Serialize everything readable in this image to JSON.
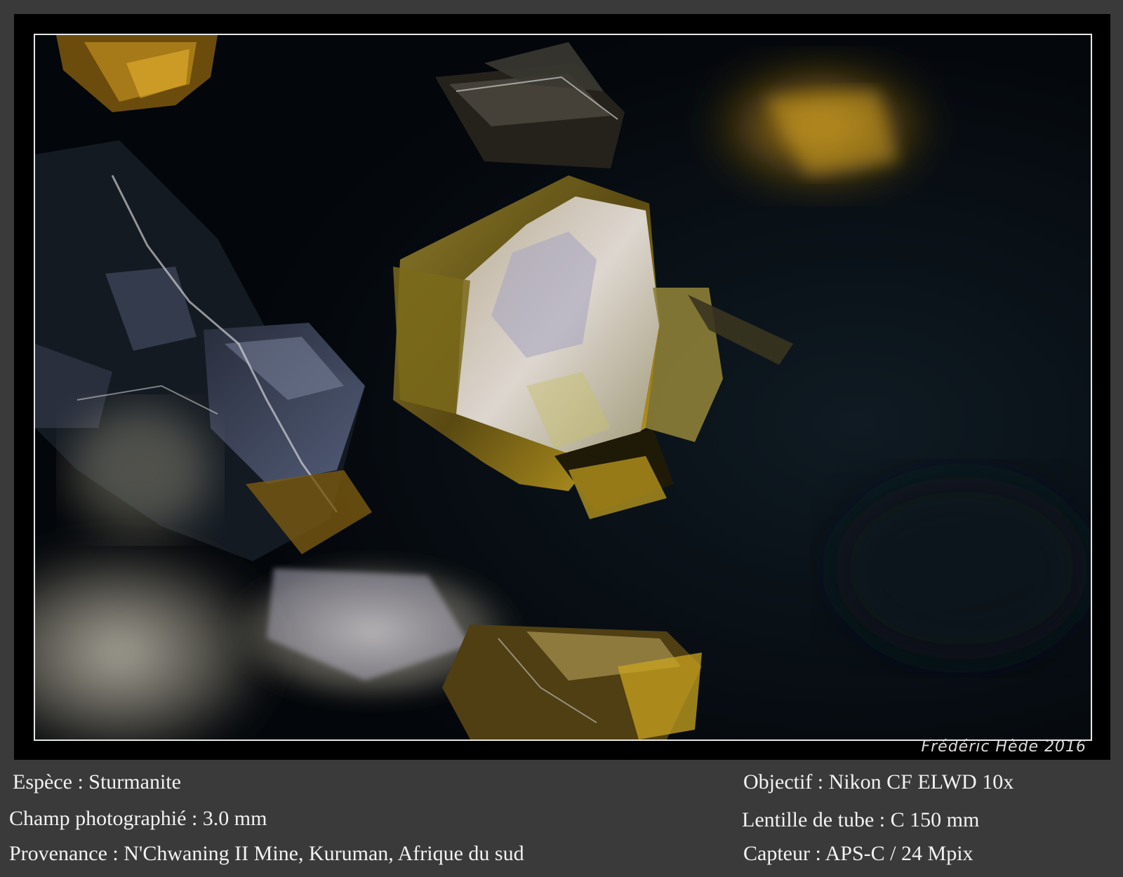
{
  "signature": "Frédéric Hède 2016",
  "caption": {
    "species": "Espèce : Sturmanite",
    "field": "Champ photographié : 3.0 mm",
    "origin": "Provenance : N'Chwaning II Mine, Kuruman, Afrique du sud",
    "objective": "Objectif : Nikon CF ELWD 10x",
    "tube_lens": "Lentille de tube : C 150 mm",
    "sensor": "Capteur : APS-C / 24 Mpix"
  }
}
